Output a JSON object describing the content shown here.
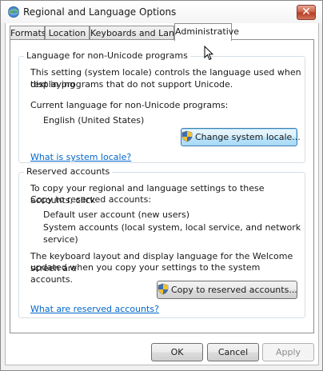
{
  "window": {
    "title": "Regional and Language Options",
    "close_label": "✕"
  },
  "tabs": [
    {
      "label": "Formats"
    },
    {
      "label": "Location"
    },
    {
      "label": "Keyboards and Languages"
    },
    {
      "label": "Administrative"
    }
  ],
  "active_tab": "Administrative",
  "non_unicode": {
    "heading": "Language for non-Unicode programs",
    "description_line1": "This setting (system locale) controls the language used when displaying",
    "description_line2": "text in programs that do not support Unicode.",
    "current_label": "Current language for non-Unicode programs:",
    "current_value": "English (United States)",
    "change_button": "Change system locale...",
    "help_link": "What is system locale?"
  },
  "reserved": {
    "heading": "Reserved accounts",
    "intro_line1": "To copy your regional and language settings to these accounts, click",
    "intro_line2": "Copy to reserved accounts:",
    "account_default": "Default user account (new users)",
    "account_system": "System accounts (local system, local service, and network service)",
    "note_line1": "The keyboard layout and display language for the Welcome screen are",
    "note_line2": "updated when you copy your settings to the system accounts.",
    "copy_button": "Copy to reserved accounts...",
    "help_link": "What are reserved accounts?"
  },
  "footer": {
    "ok": "OK",
    "cancel": "Cancel",
    "apply": "Apply"
  },
  "icons": {
    "title": "globe-icon",
    "shield": "uac-shield-icon",
    "cursor": "mouse-pointer-icon"
  }
}
